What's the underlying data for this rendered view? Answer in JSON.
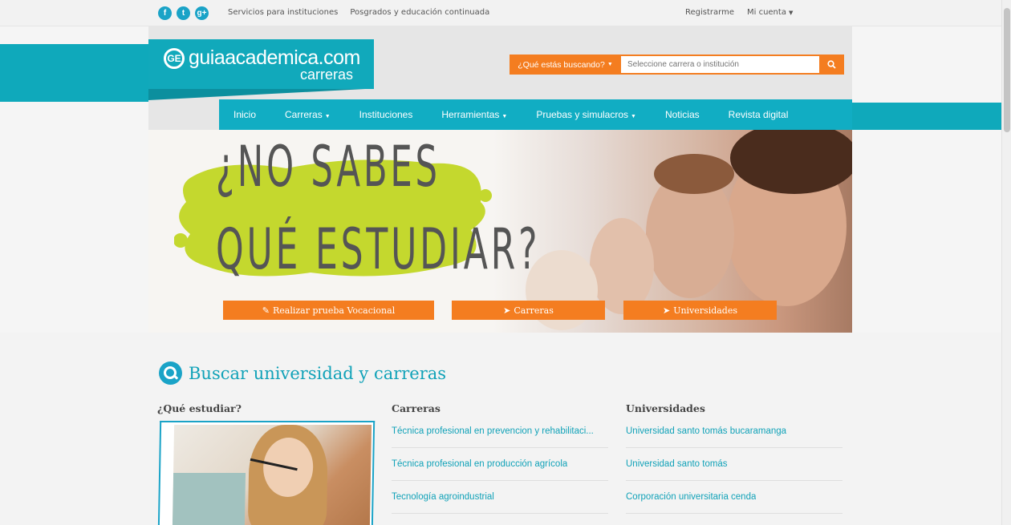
{
  "topbar": {
    "social": [
      {
        "icon": "facebook-icon",
        "glyph": "f"
      },
      {
        "icon": "twitter-icon",
        "glyph": "t"
      },
      {
        "icon": "google-plus-icon",
        "glyph": "g+"
      }
    ],
    "links": [
      "Servicios para instituciones",
      "Posgrados y educación continuada"
    ],
    "register": "Registrarme",
    "account": "Mi cuenta"
  },
  "header": {
    "logo_text": "guiaacademica.com",
    "logo_sub": "carreras",
    "search": {
      "dropdown_label": "¿Qué estás buscando?",
      "placeholder": "Seleccione carrera o institución"
    },
    "nav": [
      {
        "label": "Inicio",
        "dropdown": false
      },
      {
        "label": "Carreras",
        "dropdown": true
      },
      {
        "label": "Instituciones",
        "dropdown": false
      },
      {
        "label": "Herramientas",
        "dropdown": true
      },
      {
        "label": "Pruebas y simulacros",
        "dropdown": true
      },
      {
        "label": "Noticias",
        "dropdown": false
      },
      {
        "label": "Revista digital",
        "dropdown": false
      }
    ]
  },
  "hero": {
    "headline_1": "¿NO SABES",
    "headline_2": "QUÉ ESTUDIAR?",
    "buttons": [
      {
        "label": "Realizar prueba Vocacional",
        "icon": "pencil-icon"
      },
      {
        "label": "Carreras",
        "icon": "paper-plane-icon"
      },
      {
        "label": "Universidades",
        "icon": "paper-plane-icon"
      }
    ],
    "colors": {
      "splash": "#c4d82e",
      "accent": "#f47d20"
    }
  },
  "search_section": {
    "title": "Buscar universidad y carreras",
    "col1_heading": "¿Qué estudiar?",
    "col2_heading": "Carreras",
    "col3_heading": "Universidades",
    "careers": [
      "Técnica profesional en prevencion y rehabilitaci...",
      "Técnica profesional en producción agrícola",
      "Tecnología agroindustrial"
    ],
    "universities": [
      "Universidad santo tomás bucaramanga",
      "Universidad santo tomás",
      "Corporación universitaria cenda"
    ]
  },
  "colors": {
    "brand": "#11a9bb",
    "orange": "#f47d20"
  }
}
